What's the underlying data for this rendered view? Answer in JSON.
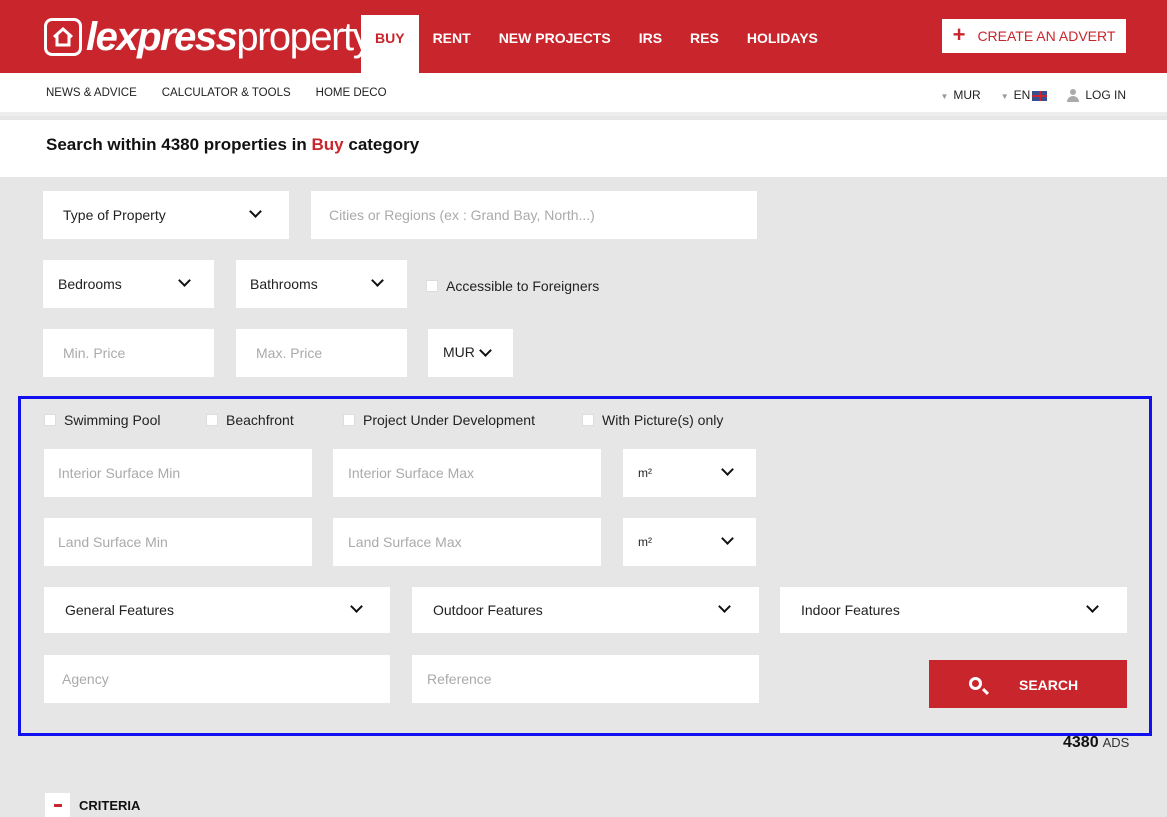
{
  "header": {
    "logo_bold": "lexpress",
    "logo_light": "property",
    "nav": [
      "BUY",
      "RENT",
      "NEW PROJECTS",
      "IRS",
      "RES",
      "HOLIDAYS"
    ],
    "active_nav": "BUY",
    "create_advert": "CREATE AN ADVERT"
  },
  "subnav": [
    "NEWS & ADVICE",
    "CALCULATOR & TOOLS",
    "HOME DECO"
  ],
  "util": {
    "currency": "MUR",
    "language": "EN",
    "login": "LOG IN"
  },
  "title": {
    "prefix": "Search within 4380 properties in",
    "category": "Buy",
    "suffix": "category"
  },
  "basic": {
    "type_of_property": "Type of Property",
    "location_placeholder": "Cities or Regions (ex : Grand Bay, North...)",
    "bedrooms": "Bedrooms",
    "bathrooms": "Bathrooms",
    "accessible": "Accessible to Foreigners",
    "min_price": "Min. Price",
    "max_price": "Max. Price",
    "price_currency": "MUR"
  },
  "advanced": {
    "swimming_pool": "Swimming Pool",
    "beachfront": "Beachfront",
    "project_dev": "Project Under Development",
    "with_pictures": "With Picture(s) only",
    "interior_min": "Interior Surface Min",
    "interior_max": "Interior Surface Max",
    "interior_unit": "m²",
    "land_min": "Land Surface Min",
    "land_max": "Land Surface Max",
    "land_unit": "m²",
    "general_features": "General Features",
    "outdoor_features": "Outdoor Features",
    "indoor_features": "Indoor Features",
    "agency": "Agency",
    "reference": "Reference",
    "search": "SEARCH"
  },
  "results": {
    "count": "4380",
    "unit": "ADS"
  },
  "criteria": "CRITERIA",
  "colors": {
    "brand": "#c9252c",
    "highlight_border": "#1010f0",
    "background": "#e6e6e6"
  }
}
